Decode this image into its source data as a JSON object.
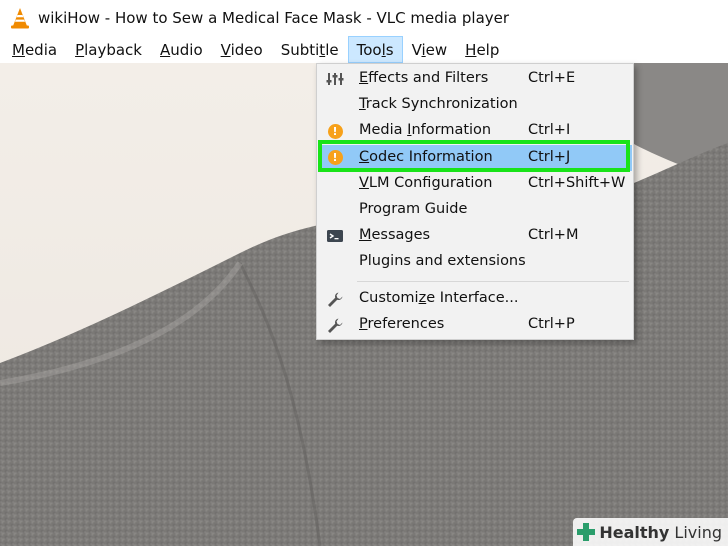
{
  "window": {
    "title": "wikiHow - How to Sew a Medical Face Mask - VLC media player",
    "app_icon": "vlc-cone-icon"
  },
  "menubar": {
    "items": [
      {
        "mnemonic": "M",
        "rest": "edia"
      },
      {
        "mnemonic": "P",
        "rest": "layback"
      },
      {
        "mnemonic": "A",
        "rest": "udio"
      },
      {
        "mnemonic": "V",
        "rest": "ideo"
      },
      {
        "pre": "Subti",
        "mnemonic": "t",
        "rest": "le"
      },
      {
        "pre": "Too",
        "mnemonic": "l",
        "rest": "s"
      },
      {
        "pre": "V",
        "mnemonic": "i",
        "rest": "ew"
      },
      {
        "mnemonic": "H",
        "rest": "elp"
      }
    ],
    "active_index": 5
  },
  "tools_menu": {
    "items": [
      {
        "mnemonic": "E",
        "rest": "ffects and Filters",
        "shortcut": "Ctrl+E",
        "icon": "equalizer-icon"
      },
      {
        "mnemonic": "T",
        "rest": "rack Synchronization",
        "shortcut": "",
        "icon": ""
      },
      {
        "pre": "Media ",
        "mnemonic": "I",
        "rest": "nformation",
        "shortcut": "Ctrl+I",
        "icon": "info-icon"
      },
      {
        "mnemonic": "C",
        "rest": "odec Information",
        "shortcut": "Ctrl+J",
        "icon": "info-icon"
      },
      {
        "mnemonic": "V",
        "rest": "LM Configuration",
        "shortcut": "Ctrl+Shift+W",
        "icon": ""
      },
      {
        "pre": "Program Guide",
        "mnemonic": "",
        "rest": "",
        "shortcut": "",
        "icon": ""
      },
      {
        "mnemonic": "M",
        "rest": "essages",
        "shortcut": "Ctrl+M",
        "icon": "terminal-icon"
      },
      {
        "pre": "Plugins and extensions",
        "mnemonic": "",
        "rest": "",
        "shortcut": "",
        "icon": ""
      },
      {
        "pre": "Customi",
        "mnemonic": "z",
        "rest": "e Interface...",
        "shortcut": "",
        "icon": "wrench-icon"
      },
      {
        "mnemonic": "P",
        "rest": "references",
        "shortcut": "Ctrl+P",
        "icon": "wrench-icon"
      }
    ],
    "highlighted_index": 3
  },
  "watermark": {
    "strong": "Healthy",
    "light": " Living"
  },
  "colors": {
    "menu_active_bg": "#cce8ff",
    "item_highlight": "#91c9f7",
    "callout_green": "#19e319",
    "info_orange": "#f7a11a",
    "vlc_orange": "#f08a00"
  }
}
